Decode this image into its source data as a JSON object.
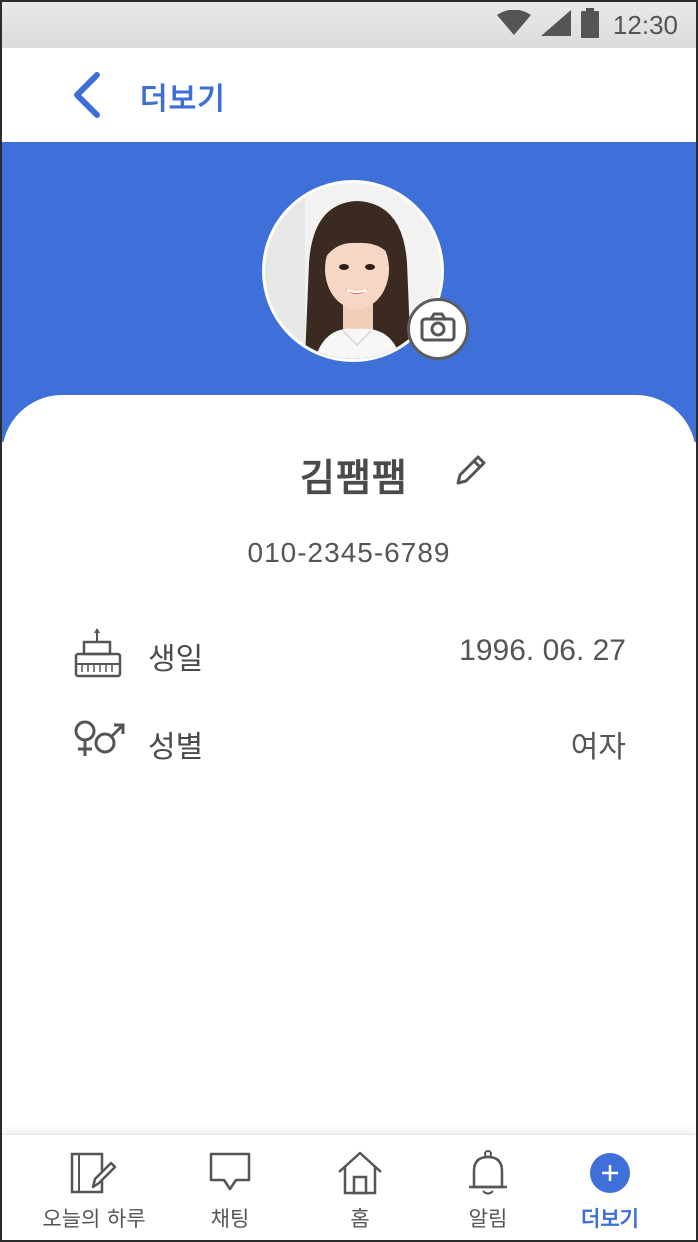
{
  "status_bar": {
    "time": "12:30",
    "icons": [
      "wifi-icon",
      "signal-icon",
      "battery-icon"
    ]
  },
  "app_bar": {
    "title": "더보기",
    "back_icon": "chevron-left-icon"
  },
  "profile": {
    "avatar_icon": "profile-photo",
    "camera_icon": "camera-icon",
    "name": "김팸팸",
    "edit_icon": "pencil-icon",
    "phone": "010-2345-6789",
    "rows": [
      {
        "icon": "birthday-cake-icon",
        "label": "생일",
        "value": "1996. 06. 27"
      },
      {
        "icon": "gender-icon",
        "label": "성별",
        "value": "여자"
      }
    ]
  },
  "bottom_nav": {
    "items": [
      {
        "icon": "diary-icon",
        "label": "오늘의 하루",
        "active": false
      },
      {
        "icon": "chat-icon",
        "label": "채팅",
        "active": false
      },
      {
        "icon": "home-icon",
        "label": "홈",
        "active": false
      },
      {
        "icon": "bell-icon",
        "label": "알림",
        "active": false
      },
      {
        "icon": "plus-circle-icon",
        "label": "더보기",
        "active": true
      }
    ]
  },
  "colors": {
    "accent": "#3f6fd8",
    "text": "#4a4a4a",
    "nav_active": "#3d6fd6"
  }
}
